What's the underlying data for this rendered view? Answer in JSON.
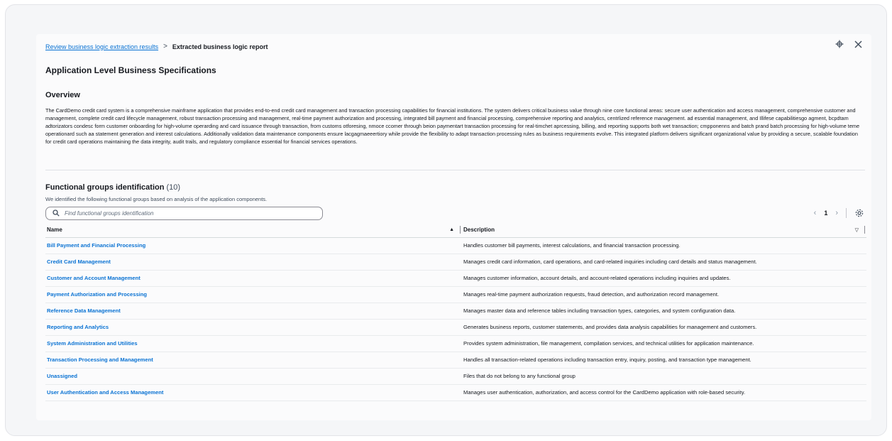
{
  "breadcrumb": {
    "parent": "Review business logic extraction results",
    "separator": ">",
    "current": "Extracted business logic report"
  },
  "header": {
    "title": "Application Level Business Specifications",
    "actions": [
      "crosshair-icon",
      "close-icon"
    ]
  },
  "overview": {
    "title": "Overview",
    "text": "The CardDemo credit card system is a comprehensive mainframe application that provides end-to-end credit card management and transaction processing capabilities for financial institutions. The system delivers critical business value through nine core functional areas: secure user authentication and access management, comprehensive customer and management, complete credit card lifecycle management, robust transaction processing and management, real-time payment authorization and processing, integrated bill payment and financial processing, comprehensive reporting and analytics, centrlized reference management. ad essential management, and Illifese capabilitiesgo agment, bcpdtam adtorizators condesc form customer onboarding for high-volume operarding and card issuance through transaction, from customs otforesing, nmoce ccomer through beion paymentart transaction processing for real-timchet aprcessing, billing, and reporting supports both wet transaction; cmpponenns and batch prand batch processing for high-volume teme operationard such aa statement generation and interest calculations. Additionally validation data maintenance components ensure lacgagmaeeertiory while provide the flexibility to adapt transaction processing rules as business requirements evolve. This integrated platform delivers significant organizational value by providing a secure, scalable foundation for credit card operations maintaining the data integrity, audit trails, and regulatory compliance essential for financial services operations."
  },
  "functional_groups": {
    "title": "Functional groups identification",
    "count": "(10)",
    "subtitle": "We identified the following functional groups based on analysis of the application components.",
    "search": {
      "placeholder": "Find functional groups identification",
      "value": "",
      "icon": "search-icon"
    },
    "pagination": {
      "prev": "‹",
      "page": "1",
      "next": "›",
      "settings_icon": "gear-icon"
    },
    "columns": {
      "name": "Name",
      "description": "Description"
    },
    "rows": [
      {
        "name": "Bill Payment and Financial Processing",
        "description": "Handles customer bill payments, interest calculations, and financial transaction processing."
      },
      {
        "name": "Credit Card Management",
        "description": "Manages credit card information, card operations, and card-related inquiries including card details and status management."
      },
      {
        "name": "Customer and Account Management",
        "description": "Manages customer information, account details, and account-related operations including inquiries and updates."
      },
      {
        "name": "Payment Authorization and Processing",
        "description": "Manages real-time payment authorization requests, fraud detection, and authorization record management."
      },
      {
        "name": "Reference Data Management",
        "description": "Manages master data and reference tables including transaction types, categories, and system configuration data."
      },
      {
        "name": "Reporting and Analytics",
        "description": "Generates business reports, customer statements, and provides data analysis capabilities for management and customers."
      },
      {
        "name": "System Administration and Utilities",
        "description": "Provides system administration, file management, compilation services, and technical utilities for application maintenance."
      },
      {
        "name": "Transaction Processing and Management",
        "description": "Handles all transaction-related operations including transaction entry, inquiry, posting, and transaction type management."
      },
      {
        "name": "Unassigned",
        "description": "Files that do not belong to any functional group"
      },
      {
        "name": "User Authentication and Access Management",
        "description": "Manages user authentication, authorization, and access control for the CardDemo application with role-based security."
      }
    ]
  },
  "colors": {
    "link": "#0972d3",
    "text": "#16191f",
    "muted": "#414d5c"
  }
}
